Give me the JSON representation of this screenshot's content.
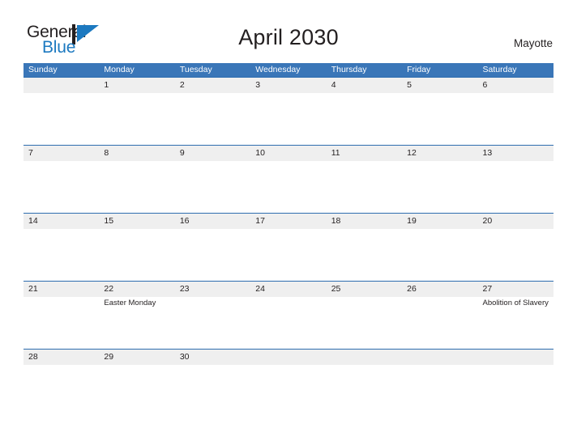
{
  "brand": {
    "word_one": "General",
    "word_two": "Blue",
    "flag_icon": "flag-icon",
    "accent_color": "#1c79c0"
  },
  "header": {
    "title": "April 2030",
    "region": "Mayotte"
  },
  "theme": {
    "header_blue": "#3a76b8",
    "band_gray": "#efefef",
    "rule_blue": "#2e6daf",
    "text": "#231f20"
  },
  "calendar": {
    "month": "April",
    "year": "2030",
    "weekdays": [
      "Sunday",
      "Monday",
      "Tuesday",
      "Wednesday",
      "Thursday",
      "Friday",
      "Saturday"
    ],
    "weeks": [
      {
        "days": [
          {
            "num": "",
            "event": ""
          },
          {
            "num": "1",
            "event": ""
          },
          {
            "num": "2",
            "event": ""
          },
          {
            "num": "3",
            "event": ""
          },
          {
            "num": "4",
            "event": ""
          },
          {
            "num": "5",
            "event": ""
          },
          {
            "num": "6",
            "event": ""
          }
        ]
      },
      {
        "days": [
          {
            "num": "7",
            "event": ""
          },
          {
            "num": "8",
            "event": ""
          },
          {
            "num": "9",
            "event": ""
          },
          {
            "num": "10",
            "event": ""
          },
          {
            "num": "11",
            "event": ""
          },
          {
            "num": "12",
            "event": ""
          },
          {
            "num": "13",
            "event": ""
          }
        ]
      },
      {
        "days": [
          {
            "num": "14",
            "event": ""
          },
          {
            "num": "15",
            "event": ""
          },
          {
            "num": "16",
            "event": ""
          },
          {
            "num": "17",
            "event": ""
          },
          {
            "num": "18",
            "event": ""
          },
          {
            "num": "19",
            "event": ""
          },
          {
            "num": "20",
            "event": ""
          }
        ]
      },
      {
        "days": [
          {
            "num": "21",
            "event": ""
          },
          {
            "num": "22",
            "event": "Easter Monday"
          },
          {
            "num": "23",
            "event": ""
          },
          {
            "num": "24",
            "event": ""
          },
          {
            "num": "25",
            "event": ""
          },
          {
            "num": "26",
            "event": ""
          },
          {
            "num": "27",
            "event": "Abolition of Slavery"
          }
        ]
      },
      {
        "days": [
          {
            "num": "28",
            "event": ""
          },
          {
            "num": "29",
            "event": ""
          },
          {
            "num": "30",
            "event": ""
          },
          {
            "num": "",
            "event": ""
          },
          {
            "num": "",
            "event": ""
          },
          {
            "num": "",
            "event": ""
          },
          {
            "num": "",
            "event": ""
          }
        ]
      }
    ]
  }
}
